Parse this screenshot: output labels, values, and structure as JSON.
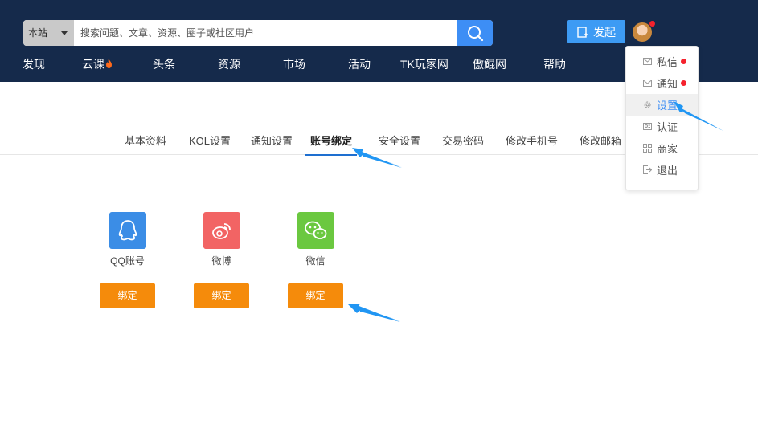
{
  "search": {
    "scope_label": "本站",
    "placeholder": "搜索问题、文章、资源、圈子或社区用户"
  },
  "header": {
    "publish_label": "发起"
  },
  "nav": {
    "items": [
      {
        "label": "发现"
      },
      {
        "label": "云课"
      },
      {
        "label": "头条"
      },
      {
        "label": "资源"
      },
      {
        "label": "市场"
      },
      {
        "label": "活动"
      },
      {
        "label": "TK玩家网"
      },
      {
        "label": "傲鲲网"
      },
      {
        "label": "帮助"
      }
    ]
  },
  "user_menu": {
    "items": [
      {
        "label": "私信",
        "icon": "mail-icon",
        "badge": true
      },
      {
        "label": "通知",
        "icon": "mail-icon",
        "badge": true
      },
      {
        "label": "设置",
        "icon": "gear-icon",
        "active": true
      },
      {
        "label": "认证",
        "icon": "id-card-icon"
      },
      {
        "label": "商家",
        "icon": "grid-icon"
      },
      {
        "label": "退出",
        "icon": "logout-icon"
      }
    ]
  },
  "settings_tabs": [
    {
      "label": "基本资料"
    },
    {
      "label": "KOL设置"
    },
    {
      "label": "通知设置"
    },
    {
      "label": "账号绑定",
      "active": true
    },
    {
      "label": "安全设置"
    },
    {
      "label": "交易密码"
    },
    {
      "label": "修改手机号"
    },
    {
      "label": "修改邮箱"
    }
  ],
  "bindings": [
    {
      "name": "QQ账号",
      "icon": "qq-icon",
      "color": "#3b8de6",
      "button": "绑定"
    },
    {
      "name": "微博",
      "icon": "weibo-icon",
      "color": "#f26464",
      "button": "绑定"
    },
    {
      "name": "微信",
      "icon": "wechat-icon",
      "color": "#6bc840",
      "button": "绑定"
    }
  ],
  "colors": {
    "header_bg": "#152a4b",
    "accent": "#3d8ef5",
    "bind_button": "#f58b0b",
    "annotation_arrow": "#2196f3"
  }
}
